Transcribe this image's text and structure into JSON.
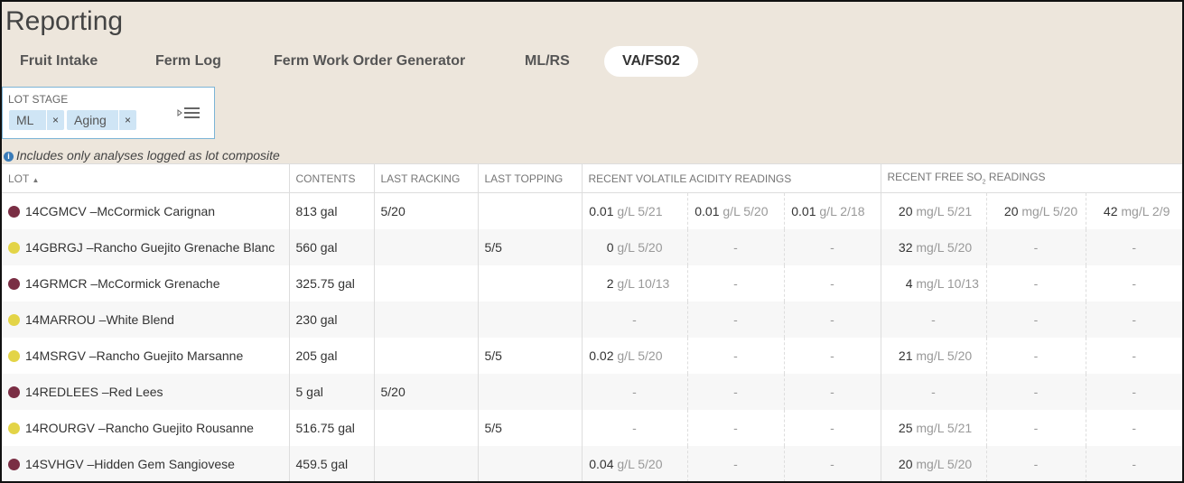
{
  "page_title": "Reporting",
  "tabs": [
    {
      "label": "Fruit Intake",
      "active": false
    },
    {
      "label": "Ferm Log",
      "active": false
    },
    {
      "label": "Ferm Work Order Generator",
      "active": false
    },
    {
      "label": "ML/RS",
      "active": false
    },
    {
      "label": "VA/FS02",
      "active": true
    }
  ],
  "filter": {
    "label": "LOT STAGE",
    "chips": [
      "ML",
      "Aging"
    ],
    "chip_remove": "×"
  },
  "note": "Includes only analyses logged as lot composite",
  "columns": {
    "lot": "LOT",
    "contents": "CONTENTS",
    "last_racking": "LAST RACKING",
    "last_topping": "LAST TOPPING",
    "va": "RECENT VOLATILE ACIDITY READINGS",
    "fso2_prefix": "RECENT FREE SO",
    "fso2_sub": "2",
    "fso2_suffix": " READINGS"
  },
  "colors": {
    "red": "#7a2e44",
    "white": "#e3d447"
  },
  "rows": [
    {
      "lot": "14CGMCV –McCormick Carignan",
      "color": "red",
      "contents": "813 gal",
      "racking": "5/20",
      "topping": "",
      "va": [
        {
          "v": "0.01",
          "u": "g/L",
          "d": "5/21"
        },
        {
          "v": "0.01",
          "u": "g/L",
          "d": "5/20"
        },
        {
          "v": "0.01",
          "u": "g/L",
          "d": "2/18"
        }
      ],
      "fso2": [
        {
          "v": "20",
          "u": "mg/L",
          "d": "5/21"
        },
        {
          "v": "20",
          "u": "mg/L",
          "d": "5/20"
        },
        {
          "v": "42",
          "u": "mg/L",
          "d": "2/9"
        }
      ]
    },
    {
      "lot": "14GBRGJ –Rancho Guejito Grenache Blanc",
      "color": "white",
      "contents": "560 gal",
      "racking": "",
      "topping": "5/5",
      "va": [
        {
          "v": "0",
          "u": "g/L",
          "d": "5/20"
        },
        "-",
        "-"
      ],
      "fso2": [
        {
          "v": "32",
          "u": "mg/L",
          "d": "5/20"
        },
        "-",
        "-"
      ]
    },
    {
      "lot": "14GRMCR –McCormick Grenache",
      "color": "red",
      "contents": "325.75 gal",
      "racking": "",
      "topping": "",
      "va": [
        {
          "v": "2",
          "u": "g/L",
          "d": "10/13"
        },
        "-",
        "-"
      ],
      "fso2": [
        {
          "v": "4",
          "u": "mg/L",
          "d": "10/13"
        },
        "-",
        "-"
      ]
    },
    {
      "lot": "14MARROU –White Blend",
      "color": "white",
      "contents": "230 gal",
      "racking": "",
      "topping": "",
      "va": [
        "-",
        "-",
        "-"
      ],
      "fso2": [
        "-",
        "-",
        "-"
      ]
    },
    {
      "lot": "14MSRGV –Rancho Guejito Marsanne",
      "color": "white",
      "contents": "205 gal",
      "racking": "",
      "topping": "5/5",
      "va": [
        {
          "v": "0.02",
          "u": "g/L",
          "d": "5/20"
        },
        "-",
        "-"
      ],
      "fso2": [
        {
          "v": "21",
          "u": "mg/L",
          "d": "5/20"
        },
        "-",
        "-"
      ]
    },
    {
      "lot": "14REDLEES –Red Lees",
      "color": "red",
      "contents": "5 gal",
      "racking": "5/20",
      "topping": "",
      "va": [
        "-",
        "-",
        "-"
      ],
      "fso2": [
        "-",
        "-",
        "-"
      ]
    },
    {
      "lot": "14ROURGV –Rancho Guejito Rousanne",
      "color": "white",
      "contents": "516.75 gal",
      "racking": "",
      "topping": "5/5",
      "va": [
        "-",
        "-",
        "-"
      ],
      "fso2": [
        {
          "v": "25",
          "u": "mg/L",
          "d": "5/21"
        },
        "-",
        "-"
      ]
    },
    {
      "lot": "14SVHGV –Hidden Gem Sangiovese",
      "color": "red",
      "contents": "459.5 gal",
      "racking": "",
      "topping": "",
      "va": [
        {
          "v": "0.04",
          "u": "g/L",
          "d": "5/20"
        },
        "-",
        "-"
      ],
      "fso2": [
        {
          "v": "20",
          "u": "mg/L",
          "d": "5/20"
        },
        "-",
        "-"
      ]
    }
  ]
}
